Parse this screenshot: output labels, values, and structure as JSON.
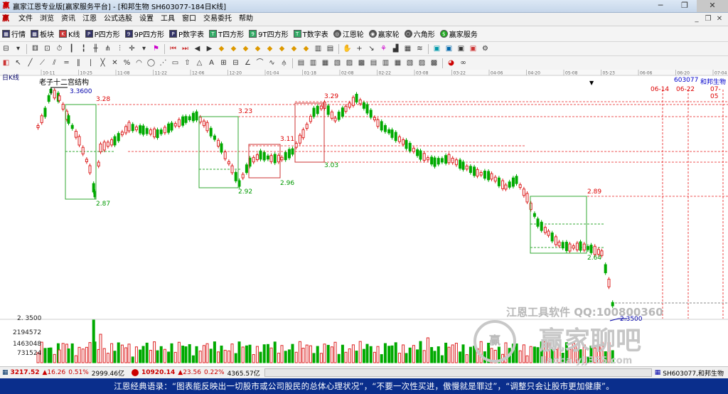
{
  "window": {
    "title": "赢家江恩专业版[赢家服务平台] - [和邦生物  SH603077-184日K线]",
    "app_icon": "app-icon",
    "controls": [
      "minimize-icon",
      "restore-icon",
      "close-icon"
    ]
  },
  "menu": {
    "items": [
      "文件",
      "浏览",
      "资讯",
      "江恩",
      "公式选股",
      "设置",
      "工具",
      "窗口",
      "交易委托",
      "帮助"
    ]
  },
  "toolbar1": {
    "items": [
      "行情",
      "板块",
      "K线",
      "P四方形",
      "9P四方形",
      "P数字表",
      "T四方形",
      "9T四方形",
      "T数字表",
      "江恩轮",
      "赢家轮",
      "六角形",
      "赢家服务"
    ]
  },
  "chart": {
    "view_label": "日K线",
    "pattern_label": "老子十二宫结构",
    "stock_code": "603077",
    "stock_name": "和邦生物",
    "dates": [
      "10-11",
      "10-25",
      "11-08",
      "11-22",
      "12-06",
      "12-20",
      "01-04",
      "01-18",
      "02-08",
      "02-22",
      "03-08",
      "03-22",
      "04-06",
      "04-20",
      "05-08",
      "05-23",
      "06-06",
      "06-20",
      "07-04"
    ],
    "future_labels": [
      "06-14",
      "06-22",
      "07-05"
    ],
    "start_price_label": "3.3600",
    "level_labels": [
      "3.28",
      "3.23",
      "3.29",
      "3.11",
      "3.03",
      "2.87",
      "2.92",
      "2.96",
      "2.89",
      "2.64",
      "2.3500"
    ],
    "volume_axis": [
      "2. 3500",
      "2194572",
      "1463048",
      "731524"
    ],
    "watermark1": "江恩工具软件  QQ:100800360",
    "watermark2": "赢家聊吧",
    "watermark3": "liaoba.yjj365.com"
  },
  "tabs": {
    "index1": {
      "value": "3217.52",
      "change": "▲16.26",
      "pct": "0.51%",
      "amount": "2999.46亿"
    },
    "index2": {
      "value": "10920.14",
      "change": "▲23.56",
      "pct": "0.22%",
      "amount": "4365.57亿"
    },
    "right_label": "SH603077,和邦生物"
  },
  "status": {
    "text": "江恩经典语录：“图表能反映出一切股市或公司股民的总体心理状况”，“不要一次性买进，傲慢就是罪过”，“调整只会让股市更加健康”。"
  }
}
